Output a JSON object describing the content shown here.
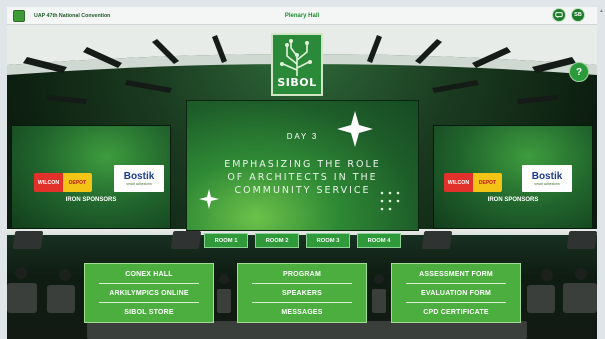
{
  "topbar": {
    "title": "UAP 47th National Convention",
    "hall": "Plenary Hall",
    "avatar_text": "SB"
  },
  "logo": {
    "word": "SIBOL"
  },
  "help": {
    "symbol": "?"
  },
  "main_screen": {
    "day": "DAY 3",
    "theme_lines": [
      "EMPHASIZING THE ROLE",
      "OF ARCHITECTS IN THE",
      "COMMUNITY SERVICE"
    ]
  },
  "sponsors": {
    "wilcon": "WILCON",
    "depot": "DEPOT",
    "bostik": "Bostik",
    "bostik_tagline": "smart adhesives",
    "caption": "IRON SPONSORS"
  },
  "rooms": [
    "ROOM 1",
    "ROOM 2",
    "ROOM 3",
    "ROOM 4"
  ],
  "menus": [
    [
      "CONEX HALL",
      "ARKILYMPICS ONLINE",
      "SIBOL STORE"
    ],
    [
      "PROGRAM",
      "SPEAKERS",
      "MESSAGES"
    ],
    [
      "ASSESSMENT FORM",
      "EVALUATION FORM",
      "CPD CERTIFICATE"
    ]
  ],
  "colors": {
    "accent": "#2f9a39",
    "menu_green": "#4cae3e",
    "title_green": "#1d8c2f"
  }
}
